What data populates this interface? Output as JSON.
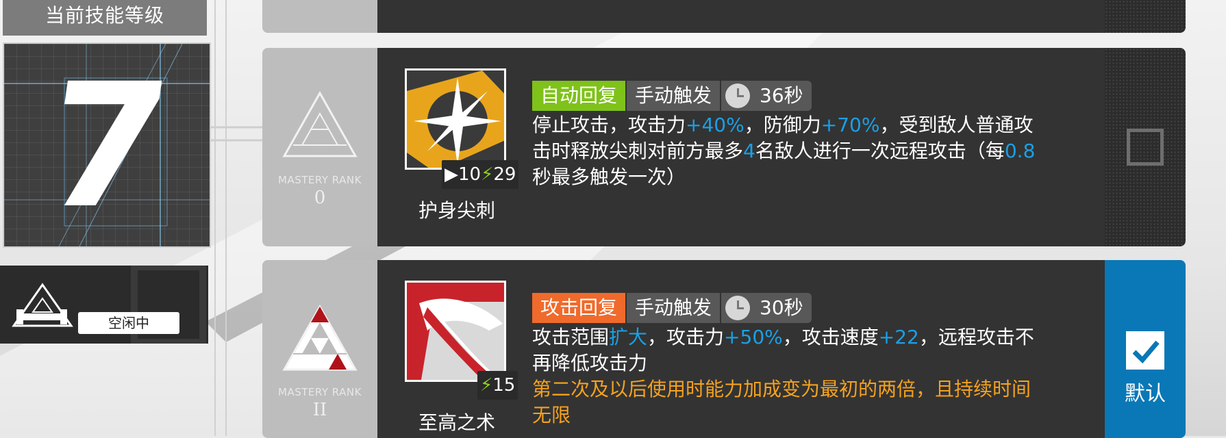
{
  "left": {
    "level_title": "当前技能等级",
    "level_value": "7",
    "status_badge": "空闲中"
  },
  "skills": [
    {
      "mastery_label": "MASTERY RANK",
      "mastery_rank": "0",
      "name": "护身尖刺",
      "initial_sp": "10",
      "sp_cost": "29",
      "recovery_tag": "自动回复",
      "trigger_tag": "手动触发",
      "duration": "36秒",
      "desc": {
        "p1": "停止攻击，攻击力",
        "v1": "+40%",
        "p2": "，防御力",
        "v2": "+70%",
        "p3": "，受到敌人普通攻",
        "p4": "击时释放尖刺对前方最多",
        "v3": "4",
        "p5": "名敌人进行一次远程攻击（每",
        "v4": "0.8",
        "p6": "秒最多触发一次）"
      },
      "selected": false
    },
    {
      "mastery_label": "MASTERY RANK",
      "mastery_rank": "II",
      "name": "至高之术",
      "sp_cost": "15",
      "recovery_tag": "攻击回复",
      "trigger_tag": "手动触发",
      "duration": "30秒",
      "desc": {
        "p1": "攻击范围",
        "v1": "扩大",
        "p2": "，攻击力",
        "v2": "+50%",
        "p3": "，攻击速度",
        "v3": "+22",
        "p4": "，远程攻击不",
        "p5": "再降低攻击力",
        "note1": "第二次及以后使用时能力加成变为最初的两倍，且持续时间",
        "note2": "无限"
      },
      "selected": true,
      "default_label": "默认"
    }
  ],
  "colors": {
    "auto_recovery": "#7fc21a",
    "attack_recovery": "#f06a2c",
    "highlight": "#1aa0e6",
    "note": "#f5a21e",
    "selected": "#0a78b6"
  }
}
